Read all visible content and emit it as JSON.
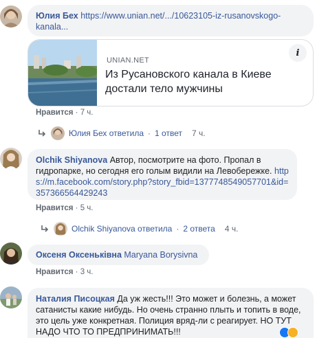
{
  "comments": [
    {
      "author": "Юлия Бех",
      "link_text": "https://www.unian.net/.../10623105-iz-rusanovskogo-kanala...",
      "like_label": "Нравится",
      "time": "7 ч.",
      "card": {
        "source": "UNIAN.NET",
        "headline": "Из Русановского канала в Киеве достали тело мужчины",
        "info_icon": "info-icon"
      },
      "reply_summary": {
        "text": "Юлия Бех ответила",
        "count": "1 ответ",
        "time": "7 ч."
      }
    },
    {
      "author": "Olchik Shiyanova",
      "text": "Автор, посмотрите на фото. Пропал в гидропарке, но сегодня его голым видили на Левобережке.",
      "link_text": "https://m.facebook.com/story.php?story_fbid=1377748549057701&id=357366564429243",
      "like_label": "Нравится",
      "time": "5 ч.",
      "reply_summary": {
        "text": "Olchik Shiyanova ответила",
        "count": "2 ответа",
        "time": "4 ч."
      }
    },
    {
      "author": "Оксеня Оксеньківна",
      "mention": "Maryana Borysivna",
      "like_label": "Нравится",
      "time": "3 ч."
    },
    {
      "author": "Наталия Писоцкая",
      "text": "Да уж жесть!!! Это может и болезнь, а может сатанисты какие нибудь. Но очень странно плыть и топить в воде, это цель уже конкретная. Полиция вряд-ли с реагирует. НО ТУТ НАДО ЧТО ТО ПРЕДПРИНИМАТЬ!!!"
    }
  ],
  "colors": {
    "link": "#385898",
    "bubble": "#f2f3f5",
    "meta": "#606770"
  }
}
